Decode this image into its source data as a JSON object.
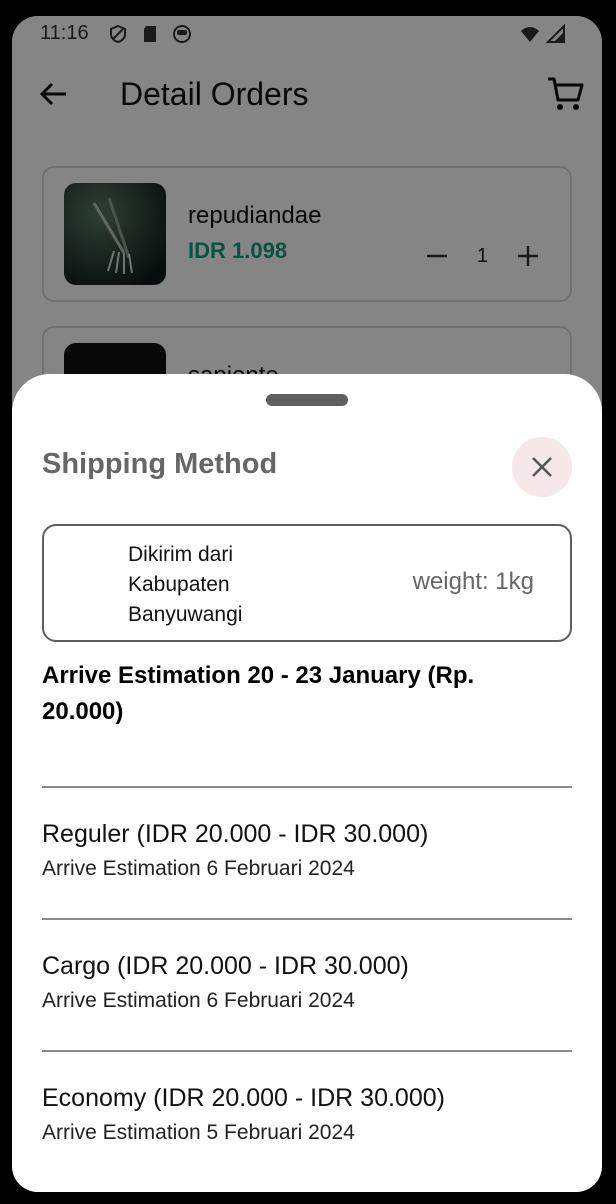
{
  "status_bar": {
    "time": "11:16"
  },
  "appbar": {
    "title": "Detail Orders"
  },
  "products": [
    {
      "name": "repudiandae",
      "price": "IDR 1.098",
      "qty": "1"
    },
    {
      "name": "sapiente",
      "price": "",
      "qty": ""
    }
  ],
  "sheet": {
    "title": "Shipping Method",
    "origin": {
      "line1": "Dikirim dari",
      "line2": "Kabupaten",
      "line3": "Banyuwangi",
      "weight": "weight: 1kg"
    },
    "arrive_estimation": "Arrive Estimation 20 - 23 January (Rp. 20.000)",
    "options": [
      {
        "name": "Reguler",
        "price_range": "(IDR 20.000 - IDR 30.000)",
        "estimate": "Arrive Estimation 6 Februari 2024"
      },
      {
        "name": "Cargo",
        "price_range": "(IDR 20.000 - IDR 30.000)",
        "estimate": "Arrive Estimation 6 Februari 2024"
      },
      {
        "name": "Economy",
        "price_range": "(IDR 20.000 - IDR 30.000)",
        "estimate": "Arrive Estimation 5 Februari 2024"
      }
    ]
  },
  "colors": {
    "accent_price": "#0e9e84",
    "close_bg": "#f6e7e8"
  },
  "icons": [
    "shield-icon",
    "sd-card-icon",
    "face-icon",
    "wifi-icon",
    "signal-icon",
    "back-arrow-icon",
    "cart-icon",
    "minus-icon",
    "plus-icon",
    "close-icon"
  ]
}
